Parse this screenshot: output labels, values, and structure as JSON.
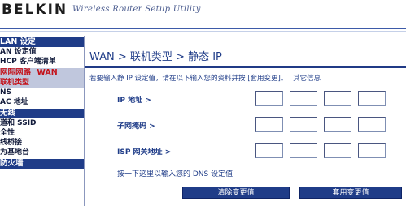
{
  "header": {
    "brand": "BELKIN",
    "tagline": "Wireless Router Setup Utility"
  },
  "sidebar": {
    "sections": [
      {
        "title": "LAN 设定",
        "items": [
          {
            "label": "AN 设定值"
          },
          {
            "label": "HCP 客户端清单"
          }
        ]
      },
      {
        "title": "网际网路",
        "title_sub": "WAN",
        "items": [
          {
            "label": "联机类型",
            "active": true
          },
          {
            "label": "NS"
          },
          {
            "label": "AC 地址"
          }
        ]
      },
      {
        "title": "无线",
        "items": [
          {
            "label": "道和 SSID"
          },
          {
            "label": "全性"
          },
          {
            "label": "线桥接"
          },
          {
            "label": "为基地台"
          }
        ]
      },
      {
        "title": "防火墙",
        "items": []
      }
    ]
  },
  "main": {
    "breadcrumb": "WAN > 联机类型 > 静态 IP",
    "instruction": "若要输入静 IP 设定值，请在以下输入您的资料并按 [套用变更]。",
    "more_info": "其它信息",
    "fields": {
      "ip_label": "IP 地址 >",
      "subnet_label": "子网掩码 >",
      "gateway_label": "ISP 网关地址 >"
    },
    "ip_values": [
      "",
      "",
      "",
      ""
    ],
    "subnet_values": [
      "",
      "",
      "",
      ""
    ],
    "gateway_values": [
      "",
      "",
      "",
      ""
    ],
    "dns_link": "按一下这里以输入您的 DNS 设定值",
    "buttons": {
      "clear": "清除变更值",
      "apply": "套用变更值"
    }
  },
  "colors": {
    "accent": "#1f3c88",
    "active_text": "#c4121a",
    "active_bg": "#c0c7dd"
  }
}
